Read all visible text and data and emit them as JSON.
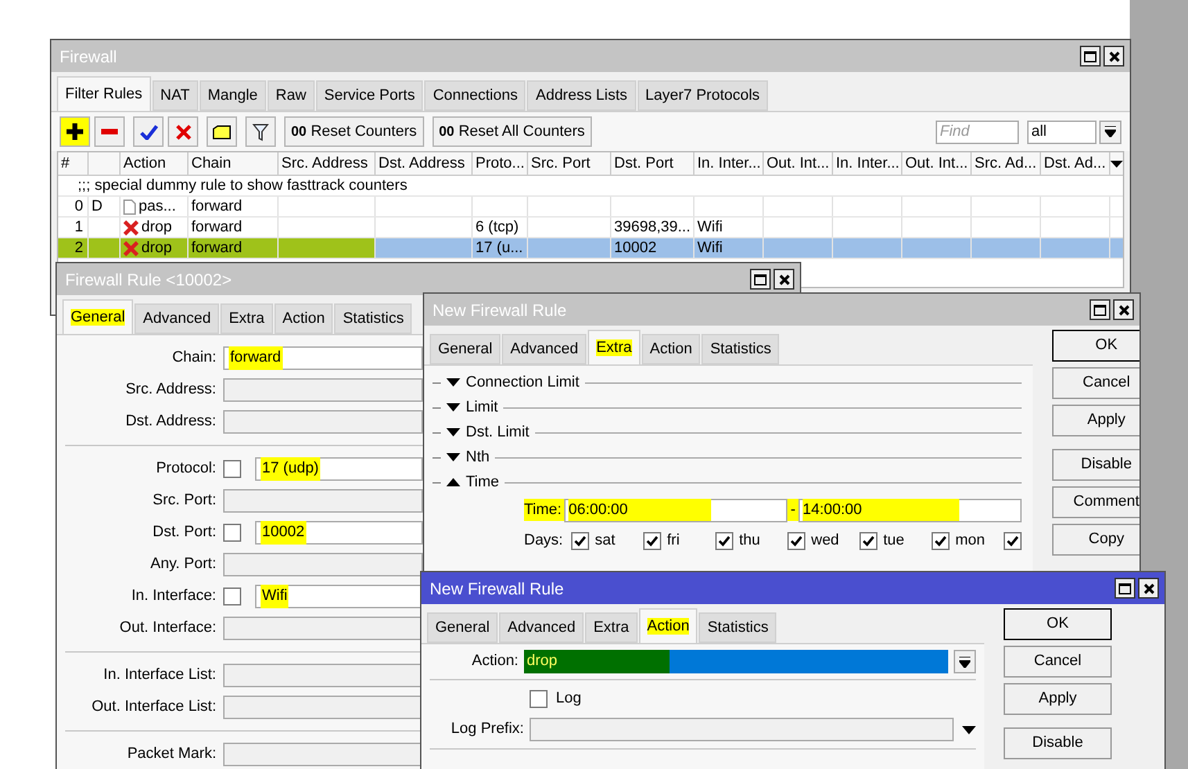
{
  "firewall": {
    "title": "Firewall",
    "active": false,
    "tabs": [
      {
        "label": "Filter Rules",
        "selected": true
      },
      {
        "label": "NAT",
        "selected": false
      },
      {
        "label": "Mangle",
        "selected": false
      },
      {
        "label": "Raw",
        "selected": false
      },
      {
        "label": "Service Ports",
        "selected": false
      },
      {
        "label": "Connections",
        "selected": false
      },
      {
        "label": "Address Lists",
        "selected": false
      },
      {
        "label": "Layer7 Protocols",
        "selected": false
      }
    ],
    "add_highlighted": true,
    "counter_buttons": [
      {
        "prefix": "00",
        "label": "Reset Counters"
      },
      {
        "prefix": "00",
        "label": "Reset All Counters"
      }
    ],
    "find": {
      "placeholder": "Find"
    },
    "filter": {
      "value": "all"
    },
    "columns": [
      "#",
      "Action",
      "Chain",
      "Src. Address",
      "Dst. Address",
      "Proto...",
      "Src. Port",
      "Dst. Port",
      "In. Inter...",
      "Out. Int...",
      "In. Inter...",
      "Out. Int...",
      "Src. Ad...",
      "Dst. Ad..."
    ],
    "rows": [
      {
        "kind": "comment",
        "text": ";;; special dummy rule to show fasttrack counters",
        "selected": false,
        "highlighted": false
      },
      {
        "kind": "rule",
        "number": "0",
        "flag": "D",
        "blocked": false,
        "action": "pas...",
        "chain": "forward",
        "selected": false,
        "highlighted": false
      },
      {
        "kind": "rule",
        "number": "1",
        "blocked": true,
        "action": "drop",
        "chain": "forward",
        "protocol": "6 (tcp)",
        "dst_port": "39698,39...",
        "in_interface": "Wifi",
        "selected": false,
        "highlighted": false
      },
      {
        "kind": "rule",
        "number": "2",
        "blocked": true,
        "action": "drop",
        "chain": "forward",
        "protocol": "17 (u...",
        "dst_port": "10002",
        "in_interface": "Wifi",
        "selected": true,
        "highlighted": true
      }
    ]
  },
  "rule_window": {
    "title": "Firewall Rule <10002>",
    "active": false,
    "tabs": [
      {
        "label": "General",
        "selected": true,
        "highlighted": true
      },
      {
        "label": "Advanced",
        "selected": false,
        "highlighted": false
      },
      {
        "label": "Extra",
        "selected": false,
        "highlighted": false
      },
      {
        "label": "Action",
        "selected": false,
        "highlighted": false
      },
      {
        "label": "Statistics",
        "selected": false,
        "highlighted": false
      }
    ],
    "groups": [
      [
        {
          "label": "Chain:",
          "value": "forward",
          "highlighted": true
        },
        {
          "label": "Src. Address:"
        },
        {
          "label": "Dst. Address:"
        }
      ],
      [
        {
          "label": "Protocol:",
          "negate": {
            "checked": false
          },
          "value": "17 (udp)",
          "highlighted": true
        },
        {
          "label": "Src. Port:"
        },
        {
          "label": "Dst. Port:",
          "negate": {
            "checked": false
          },
          "value": "10002",
          "highlighted": true
        },
        {
          "label": "Any. Port:"
        },
        {
          "label": "In. Interface:",
          "negate": {
            "checked": false
          },
          "value": "Wifi",
          "highlighted": true
        },
        {
          "label": "Out. Interface:"
        }
      ],
      [
        {
          "label": "In. Interface List:"
        },
        {
          "label": "Out. Interface List:"
        }
      ],
      [
        {
          "label": "Packet Mark:"
        }
      ]
    ]
  },
  "extra_window": {
    "title": "New Firewall Rule",
    "active": false,
    "tabs": [
      {
        "label": "General",
        "selected": false,
        "highlighted": false
      },
      {
        "label": "Advanced",
        "selected": false,
        "highlighted": false
      },
      {
        "label": "Extra",
        "selected": true,
        "highlighted": true
      },
      {
        "label": "Action",
        "selected": false,
        "highlighted": false
      },
      {
        "label": "Statistics",
        "selected": false,
        "highlighted": false
      }
    ],
    "sections": [
      {
        "label": "Connection Limit",
        "expanded": false
      },
      {
        "label": "Limit",
        "expanded": false
      },
      {
        "label": "Dst. Limit",
        "expanded": false
      },
      {
        "label": "Nth",
        "expanded": false
      },
      {
        "label": "Time",
        "expanded": true
      }
    ],
    "time": {
      "label": "Time:",
      "from": "06:00:00",
      "separator": "-",
      "to": "14:00:00",
      "highlighted": true
    },
    "days": {
      "label": "Days:",
      "items": [
        {
          "label": "sat",
          "checked": true
        },
        {
          "label": "fri",
          "checked": true
        },
        {
          "label": "thu",
          "checked": true
        },
        {
          "label": "wed",
          "checked": true
        },
        {
          "label": "tue",
          "checked": true
        },
        {
          "label": "mon",
          "checked": true
        },
        {
          "checked": true
        }
      ]
    },
    "buttons": [
      {
        "label": "OK",
        "default": true
      },
      {
        "label": "Cancel",
        "default": false
      },
      {
        "label": "Apply",
        "default": false
      },
      {
        "label": "Disable",
        "default": false
      },
      {
        "label": "Comment",
        "default": false
      },
      {
        "label": "Copy",
        "default": false
      }
    ]
  },
  "action_window": {
    "title": "New Firewall Rule",
    "active": true,
    "tabs": [
      {
        "label": "General",
        "selected": false,
        "highlighted": false
      },
      {
        "label": "Advanced",
        "selected": false,
        "highlighted": false
      },
      {
        "label": "Extra",
        "selected": false,
        "highlighted": false
      },
      {
        "label": "Action",
        "selected": true,
        "highlighted": true
      },
      {
        "label": "Statistics",
        "selected": false,
        "highlighted": false
      }
    ],
    "action": {
      "label": "Action:",
      "value": "drop",
      "highlighted": true
    },
    "log": {
      "label": "Log",
      "checked": false
    },
    "log_prefix": {
      "label": "Log Prefix:"
    },
    "buttons": [
      {
        "label": "OK",
        "default": true
      },
      {
        "label": "Cancel",
        "default": false
      },
      {
        "label": "Apply",
        "default": false
      },
      {
        "label": "Disable",
        "default": false
      }
    ]
  }
}
